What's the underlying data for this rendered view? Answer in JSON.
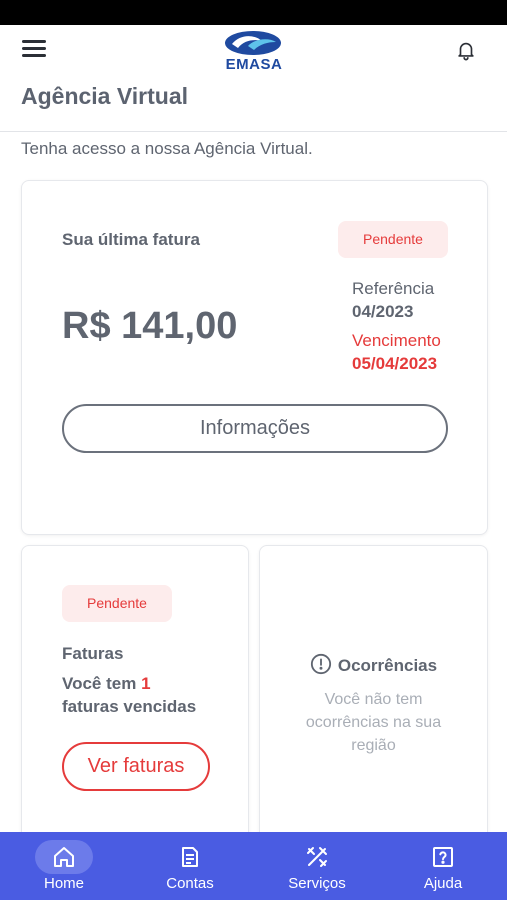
{
  "app": {
    "brand": "EMASA",
    "page_title": "Agência Virtual",
    "intro": "Tenha acesso a nossa Agência Virtual.",
    "colors": {
      "accent": "#4a5ce2",
      "alert": "#e53b3b",
      "badge_bg": "#fdecec",
      "text": "#5f6570"
    }
  },
  "header": {
    "menu_icon": "hamburger-icon",
    "bell_icon": "bell-icon"
  },
  "invoice": {
    "label": "Sua última fatura",
    "status": "Pendente",
    "amount": "R$ 141,00",
    "reference_label": "Referência",
    "reference_value": "04/2023",
    "due_label": "Vencimento",
    "due_value": "05/04/2023",
    "info_button": "Informações"
  },
  "bills": {
    "status": "Pendente",
    "title": "Faturas",
    "text_prefix": "Você tem ",
    "count": "1",
    "text_suffix": "faturas vencidas",
    "button": "Ver faturas"
  },
  "occurrences": {
    "title": "Ocorrências",
    "icon": "alert-circle-icon",
    "message": "Você não tem ocorrências na sua região"
  },
  "nav": {
    "items": [
      {
        "label": "Home",
        "icon": "home-icon",
        "active": true
      },
      {
        "label": "Contas",
        "icon": "document-icon",
        "active": false
      },
      {
        "label": "Serviços",
        "icon": "tools-icon",
        "active": false
      },
      {
        "label": "Ajuda",
        "icon": "help-icon",
        "active": false
      }
    ]
  }
}
